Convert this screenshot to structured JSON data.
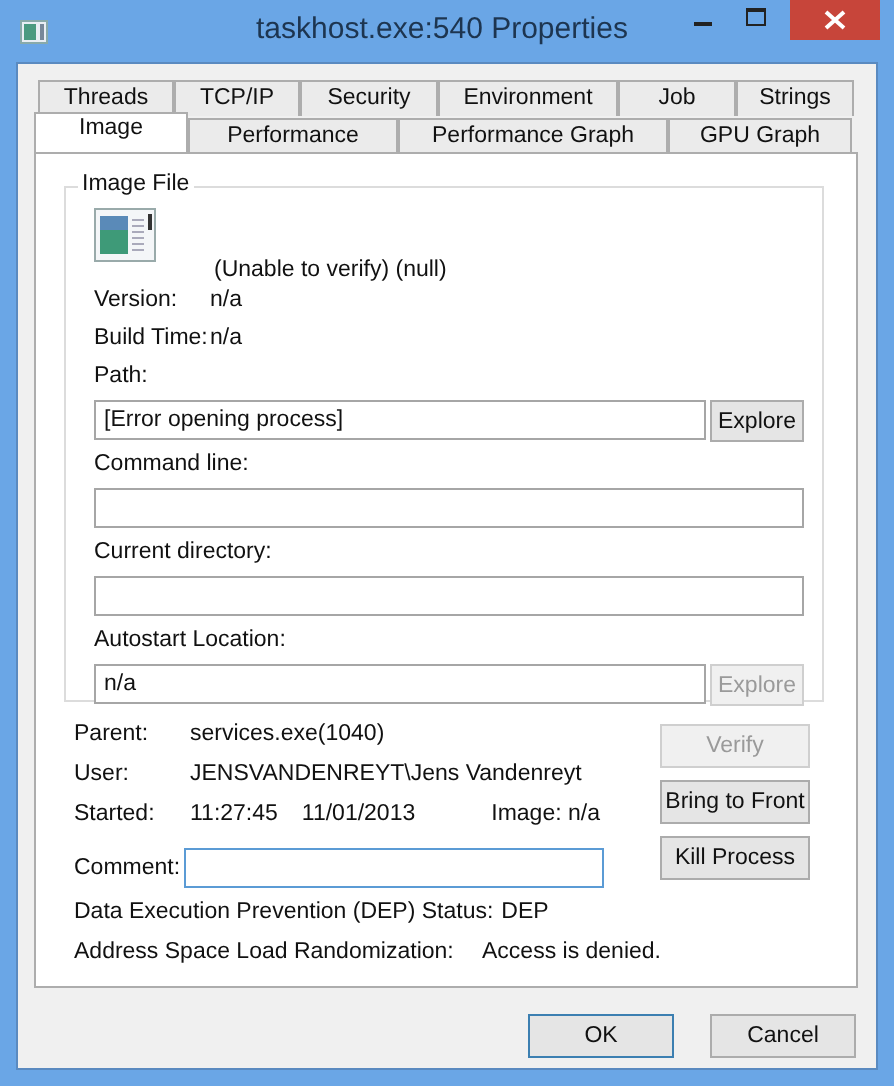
{
  "window": {
    "title": "taskhost.exe:540 Properties"
  },
  "tab_rows": [
    [
      {
        "label": "Threads",
        "selected": false
      },
      {
        "label": "TCP/IP",
        "selected": false
      },
      {
        "label": "Security",
        "selected": false
      },
      {
        "label": "Environment",
        "selected": false
      },
      {
        "label": "Job",
        "selected": false
      },
      {
        "label": "Strings",
        "selected": false
      }
    ],
    [
      {
        "label": "Image",
        "selected": true
      },
      {
        "label": "Performance",
        "selected": false
      },
      {
        "label": "Performance Graph",
        "selected": false
      },
      {
        "label": "GPU Graph",
        "selected": false
      }
    ]
  ],
  "image_file": {
    "title": "Image File",
    "verification": "(Unable to verify) (null)",
    "info": [
      {
        "label": "Version:",
        "value": "n/a"
      },
      {
        "label": "Build Time:",
        "value": "n/a"
      }
    ],
    "fields": [
      {
        "label": "Path:",
        "value": "[Error opening process]",
        "button": {
          "label": "Explore",
          "disabled": false
        }
      },
      {
        "label": "Command line:"
      },
      {
        "label": "Current directory:"
      },
      {
        "label": "Autostart Location:",
        "value": "n/a",
        "button": {
          "label": "Explore",
          "disabled": true
        }
      }
    ]
  },
  "details": [
    {
      "label": "Parent:",
      "values": [
        "services.exe(1040)"
      ]
    },
    {
      "label": "User:",
      "values": [
        "JENSVANDENREYT\\Jens Vandenreyt"
      ]
    },
    {
      "label": "Started:",
      "values": [
        "11:27:45",
        "11/01/2013",
        "Image: n/a"
      ]
    }
  ],
  "comment": {
    "label": "Comment:",
    "focused": true
  },
  "actions": [
    {
      "label": "Verify",
      "disabled": true
    },
    {
      "label": "Bring to Front",
      "disabled": false
    },
    {
      "label": "Kill Process",
      "disabled": false
    }
  ],
  "security": [
    {
      "label": "Data Execution Prevention (DEP) Status:",
      "value": "DEP"
    },
    {
      "label": "Address Space Load Randomization:",
      "value": "Access is denied."
    }
  ],
  "dialog_buttons": [
    {
      "label": "OK",
      "default": true
    },
    {
      "label": "Cancel",
      "default": false
    }
  ]
}
